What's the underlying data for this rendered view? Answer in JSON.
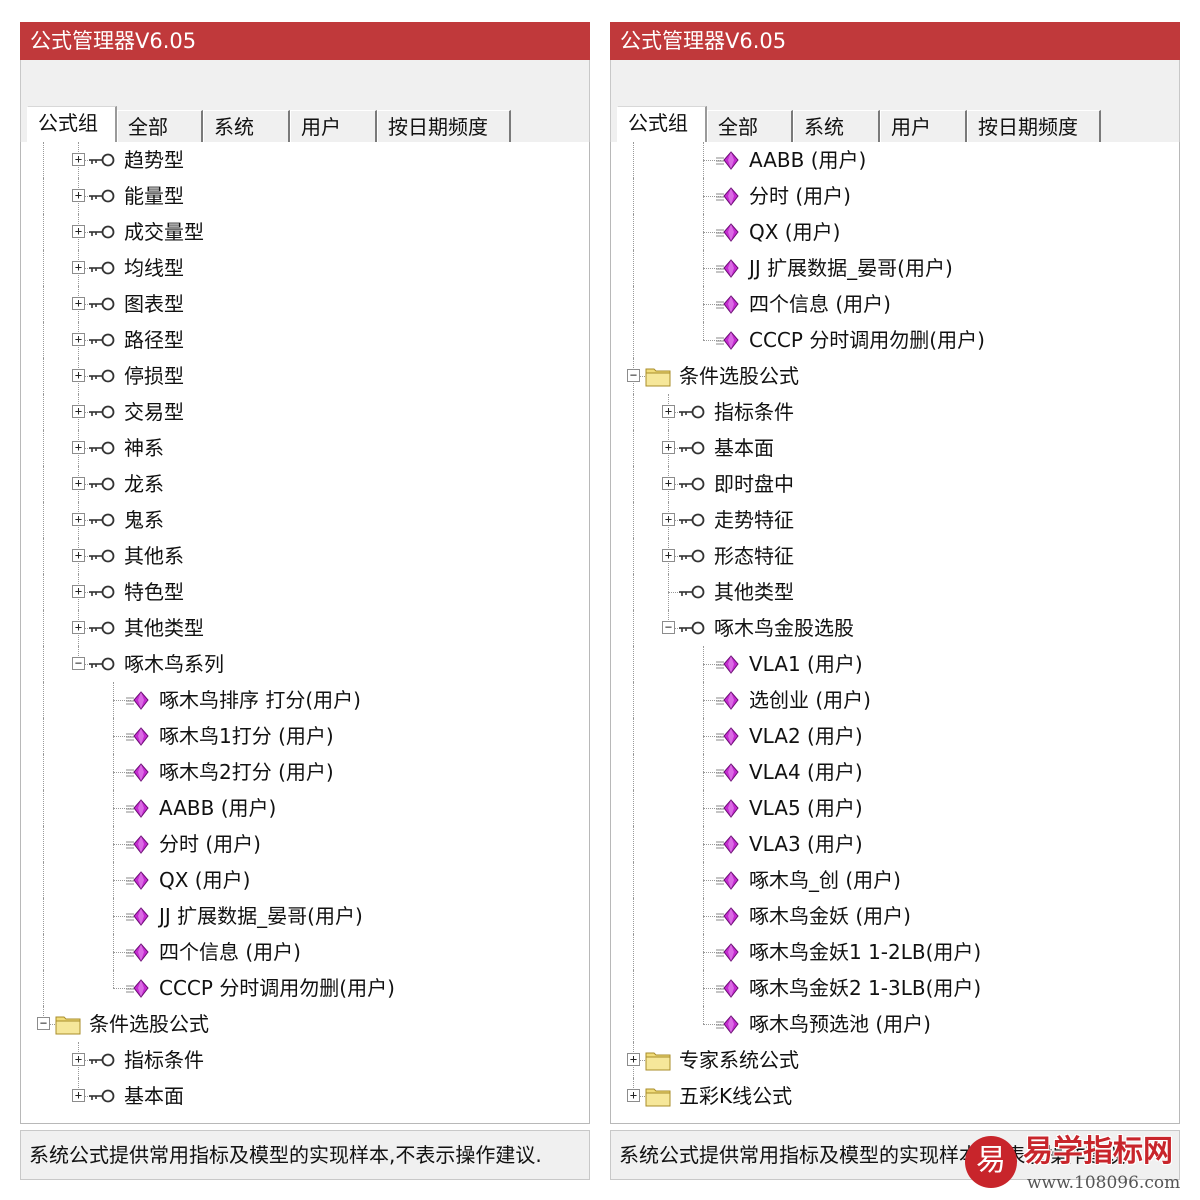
{
  "colors": {
    "titlebar": "#c0393b",
    "formula_icon": "#c42bd0",
    "folder_icon": "#f1dc7a",
    "watermark": "#c8252b"
  },
  "left": {
    "title": "公式管理器V6.05",
    "tabs": [
      {
        "label": "公式组",
        "active": true
      },
      {
        "label": "全部"
      },
      {
        "label": "系统"
      },
      {
        "label": "用户"
      },
      {
        "label": "按日期频度"
      }
    ],
    "rows": [
      {
        "level": 1,
        "icon": "key-icon",
        "expander": "plus",
        "label": "趋势型"
      },
      {
        "level": 1,
        "icon": "key-icon",
        "expander": "plus",
        "label": "能量型"
      },
      {
        "level": 1,
        "icon": "key-icon",
        "expander": "plus",
        "label": "成交量型"
      },
      {
        "level": 1,
        "icon": "key-icon",
        "expander": "plus",
        "label": "均线型"
      },
      {
        "level": 1,
        "icon": "key-icon",
        "expander": "plus",
        "label": "图表型"
      },
      {
        "level": 1,
        "icon": "key-icon",
        "expander": "plus",
        "label": "路径型"
      },
      {
        "level": 1,
        "icon": "key-icon",
        "expander": "plus",
        "label": "停损型"
      },
      {
        "level": 1,
        "icon": "key-icon",
        "expander": "plus",
        "label": "交易型"
      },
      {
        "level": 1,
        "icon": "key-icon",
        "expander": "plus",
        "label": "神系"
      },
      {
        "level": 1,
        "icon": "key-icon",
        "expander": "plus",
        "label": "龙系"
      },
      {
        "level": 1,
        "icon": "key-icon",
        "expander": "plus",
        "label": "鬼系"
      },
      {
        "level": 1,
        "icon": "key-icon",
        "expander": "plus",
        "label": "其他系"
      },
      {
        "level": 1,
        "icon": "key-icon",
        "expander": "plus",
        "label": "特色型"
      },
      {
        "level": 1,
        "icon": "key-icon",
        "expander": "plus",
        "label": "其他类型"
      },
      {
        "level": 1,
        "icon": "key-icon",
        "expander": "minus",
        "label": "啄木鸟系列"
      },
      {
        "level": 2,
        "icon": "formula-icon",
        "label": "啄木鸟排序  打分(用户)"
      },
      {
        "level": 2,
        "icon": "formula-icon",
        "label": "啄木鸟1打分  (用户)"
      },
      {
        "level": 2,
        "icon": "formula-icon",
        "label": "啄木鸟2打分  (用户)"
      },
      {
        "level": 2,
        "icon": "formula-icon",
        "label": "AABB  (用户)"
      },
      {
        "level": 2,
        "icon": "formula-icon",
        "label": "分时  (用户)"
      },
      {
        "level": 2,
        "icon": "formula-icon",
        "label": "QX  (用户)"
      },
      {
        "level": 2,
        "icon": "formula-icon",
        "label": "JJ  扩展数据_晏哥(用户)"
      },
      {
        "level": 2,
        "icon": "formula-icon",
        "label": "四个信息  (用户)"
      },
      {
        "level": 2,
        "icon": "formula-icon",
        "label": "CCCP  分时调用勿删(用户)"
      },
      {
        "level": 0,
        "icon": "folder-icon",
        "expander": "minus",
        "label": "条件选股公式"
      },
      {
        "level": 1,
        "icon": "key-icon",
        "expander": "plus",
        "label": "指标条件"
      },
      {
        "level": 1,
        "icon": "key-icon",
        "expander": "plus",
        "label": "基本面"
      }
    ],
    "status": "系统公式提供常用指标及模型的实现样本,不表示操作建议."
  },
  "right": {
    "title": "公式管理器V6.05",
    "tabs": [
      {
        "label": "公式组",
        "active": true
      },
      {
        "label": "全部"
      },
      {
        "label": "系统"
      },
      {
        "label": "用户"
      },
      {
        "label": "按日期频度"
      }
    ],
    "rows": [
      {
        "level": 2,
        "icon": "formula-icon",
        "label": "AABB  (用户)"
      },
      {
        "level": 2,
        "icon": "formula-icon",
        "label": "分时  (用户)"
      },
      {
        "level": 2,
        "icon": "formula-icon",
        "label": "QX  (用户)"
      },
      {
        "level": 2,
        "icon": "formula-icon",
        "label": "JJ  扩展数据_晏哥(用户)"
      },
      {
        "level": 2,
        "icon": "formula-icon",
        "label": "四个信息  (用户)"
      },
      {
        "level": 2,
        "icon": "formula-icon",
        "label": "CCCP  分时调用勿删(用户)"
      },
      {
        "level": 0,
        "icon": "folder-icon",
        "expander": "minus",
        "label": "条件选股公式"
      },
      {
        "level": 1,
        "icon": "key-icon",
        "expander": "plus",
        "label": "指标条件"
      },
      {
        "level": 1,
        "icon": "key-icon",
        "expander": "plus",
        "label": "基本面"
      },
      {
        "level": 1,
        "icon": "key-icon",
        "expander": "plus",
        "label": "即时盘中"
      },
      {
        "level": 1,
        "icon": "key-icon",
        "expander": "plus",
        "label": "走势特征"
      },
      {
        "level": 1,
        "icon": "key-icon",
        "expander": "plus",
        "label": "形态特征"
      },
      {
        "level": 1,
        "icon": "key-icon",
        "expander": "none",
        "label": "其他类型"
      },
      {
        "level": 1,
        "icon": "key-icon",
        "expander": "minus",
        "label": "啄木鸟金股选股"
      },
      {
        "level": 2,
        "icon": "formula-icon",
        "label": "VLA1  (用户)"
      },
      {
        "level": 2,
        "icon": "formula-icon",
        "label": "选创业  (用户)"
      },
      {
        "level": 2,
        "icon": "formula-icon",
        "label": "VLA2  (用户)"
      },
      {
        "level": 2,
        "icon": "formula-icon",
        "label": "VLA4  (用户)"
      },
      {
        "level": 2,
        "icon": "formula-icon",
        "label": "VLA5  (用户)"
      },
      {
        "level": 2,
        "icon": "formula-icon",
        "label": "VLA3  (用户)"
      },
      {
        "level": 2,
        "icon": "formula-icon",
        "label": "啄木鸟_创  (用户)"
      },
      {
        "level": 2,
        "icon": "formula-icon",
        "label": "啄木鸟金妖  (用户)"
      },
      {
        "level": 2,
        "icon": "formula-icon",
        "label": "啄木鸟金妖1  1-2LB(用户)"
      },
      {
        "level": 2,
        "icon": "formula-icon",
        "label": "啄木鸟金妖2  1-3LB(用户)"
      },
      {
        "level": 2,
        "icon": "formula-icon",
        "label": "啄木鸟预选池  (用户)"
      },
      {
        "level": 0,
        "icon": "folder-icon",
        "expander": "plus",
        "label": "专家系统公式"
      },
      {
        "level": 0,
        "icon": "folder-icon",
        "expander": "plus",
        "label": "五彩K线公式"
      }
    ],
    "status": "系统公式提供常用指标及模型的实现样本,不表示操作建议."
  },
  "watermark": {
    "logo_char": "易",
    "name": "易学指标网",
    "url": "www.108096.com"
  }
}
